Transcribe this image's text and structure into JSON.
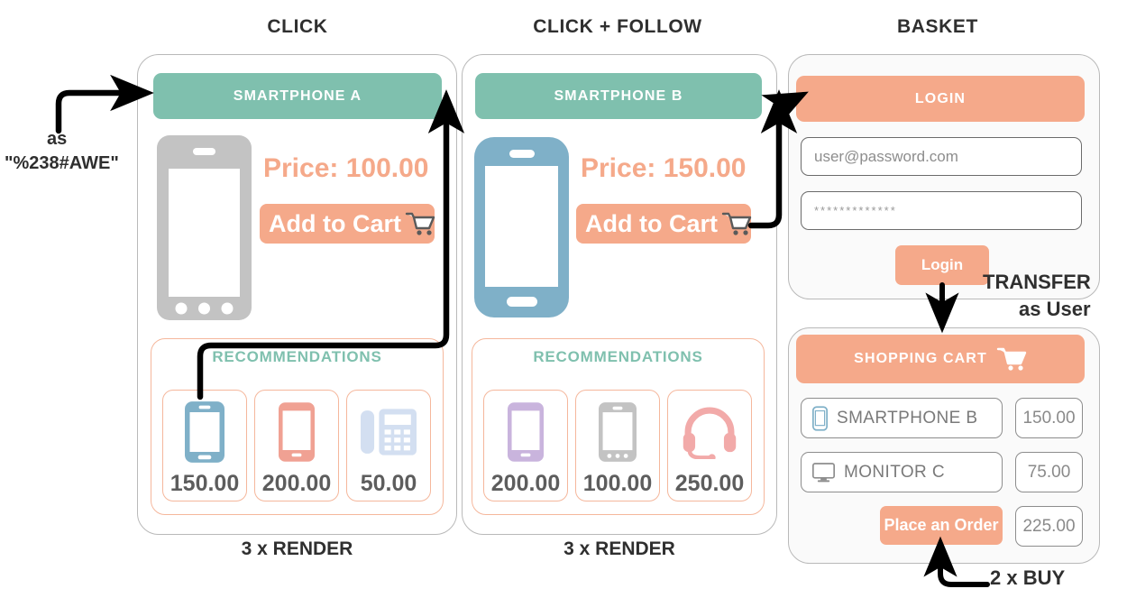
{
  "headers": {
    "click": "CLICK",
    "click_follow": "CLICK + FOLLOW",
    "basket": "BASKET"
  },
  "entry_annotation": {
    "line1": "as",
    "line2": "\"%238#AWE\""
  },
  "panel_a": {
    "title": "SMARTPHONE A",
    "price": "Price: 100.00",
    "add_to_cart": "Add to Cart",
    "cart_icon": "shopping-cart-icon",
    "device_icon": "smartphone-gray-icon",
    "recommendations": {
      "title": "RECOMMENDATIONS",
      "items": [
        {
          "icon": "smartphone-blue-icon",
          "price": "150.00"
        },
        {
          "icon": "smartphone-salmon-icon",
          "price": "200.00"
        },
        {
          "icon": "landline-phone-icon",
          "price": "50.00"
        }
      ]
    },
    "footer_label": "3 x RENDER"
  },
  "panel_b": {
    "title": "SMARTPHONE B",
    "price": "Price: 150.00",
    "add_to_cart": "Add to Cart",
    "cart_icon": "shopping-cart-icon",
    "device_icon": "smartphone-blue-icon",
    "recommendations": {
      "title": "RECOMMENDATIONS",
      "items": [
        {
          "icon": "smartphone-purple-icon",
          "price": "200.00"
        },
        {
          "icon": "smartphone-gray-icon",
          "price": "100.00"
        },
        {
          "icon": "headset-icon",
          "price": "250.00"
        }
      ]
    },
    "footer_label": "3 x RENDER"
  },
  "login": {
    "title": "LOGIN",
    "email_placeholder": "user@password.com",
    "password_value": "*************",
    "submit_label": "Login"
  },
  "transfer": {
    "line1": "TRANSFER",
    "line2": "as User"
  },
  "cart": {
    "title": "SHOPPING CART",
    "cart_icon": "shopping-cart-icon",
    "rows": [
      {
        "icon": "smartphone-outline-icon",
        "label": "SMARTPHONE B",
        "amount": "150.00"
      },
      {
        "icon": "monitor-icon",
        "label": "MONITOR C",
        "amount": "75.00"
      }
    ],
    "order_button": "Place an Order",
    "total": "225.00",
    "footer_label": "2 x BUY"
  },
  "colors": {
    "teal": "#7fc0ae",
    "orange": "#f5a98a",
    "blue": "#7fb0c8",
    "gray": "#c3c3c3",
    "salmon": "#f0a193",
    "purple": "#c9b4dd",
    "lightblue": "#d3dff1",
    "pink": "#f2aaa9",
    "panel_border": "#b9b9b9",
    "rec_border": "#f5b79c"
  }
}
